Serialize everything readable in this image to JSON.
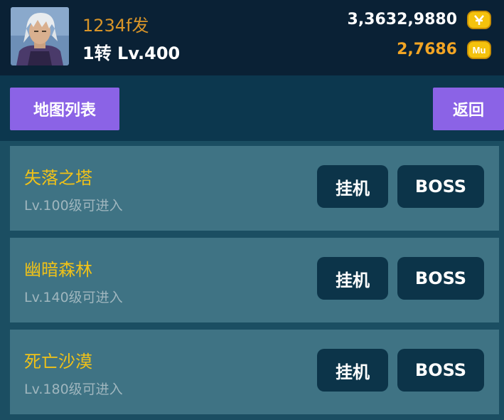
{
  "player": {
    "name": "1234f发",
    "level": "1转 Lv.400"
  },
  "currency": {
    "gold": "3,3632,9880",
    "mu": "2,7686",
    "gold_icon_color": "#f4c20d",
    "mu_icon_label": "Mu"
  },
  "toolbar": {
    "map_list_label": "地图列表",
    "back_label": "返回"
  },
  "maps": [
    {
      "name": "失落之塔",
      "requirement": "Lv.100级可进入",
      "afk_label": "挂机",
      "boss_label": "BOSS"
    },
    {
      "name": "幽暗森林",
      "requirement": "Lv.140级可进入",
      "afk_label": "挂机",
      "boss_label": "BOSS"
    },
    {
      "name": "死亡沙漠",
      "requirement": "Lv.180级可进入",
      "afk_label": "挂机",
      "boss_label": "BOSS"
    }
  ],
  "colors": {
    "accent_purple": "#8b63e6",
    "map_name_yellow": "#f0c218",
    "header_bg": "#0a2135",
    "row_bg": "#3f7384"
  }
}
